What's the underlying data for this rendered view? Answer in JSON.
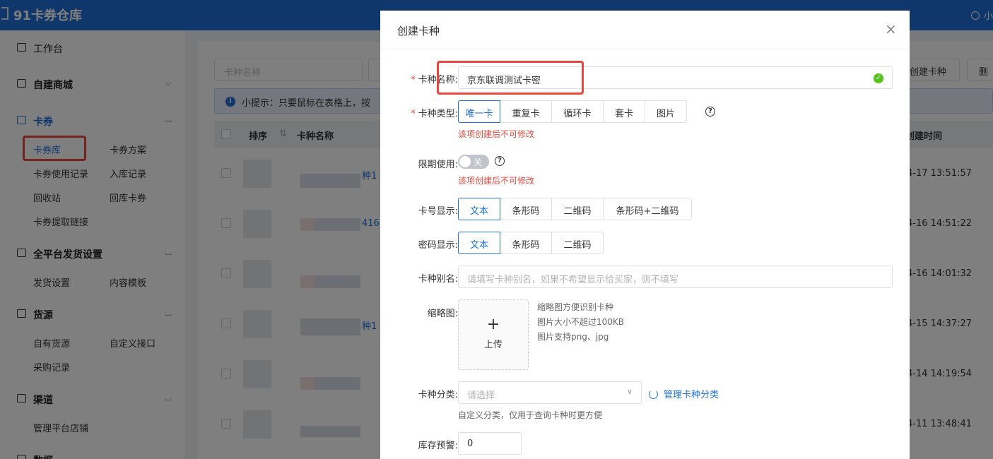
{
  "header": {
    "app_title": "91卡券仓库",
    "user_text": "小"
  },
  "sidebar": {
    "groups": [
      {
        "label": "工作台"
      },
      {
        "label": "自建商城"
      },
      {
        "label": "卡券"
      },
      {
        "label": "全平台发货设置"
      },
      {
        "label": "货源"
      },
      {
        "label": "渠道"
      },
      {
        "label": "数据"
      }
    ],
    "card_items": [
      "卡券库",
      "卡券方案",
      "卡券使用记录",
      "入库记录",
      "回收站",
      "回库卡券",
      "卡券提取链接"
    ],
    "shipping_items": [
      "发货设置",
      "内容模板"
    ],
    "source_items": [
      "自有货源",
      "自定义接口",
      "采购记录"
    ],
    "channel_items": [
      "管理平台店铺"
    ]
  },
  "main": {
    "search_placeholder": "卡种名称",
    "tip_icon": "i",
    "tip": "小提示：只要鼠标在表格上，按",
    "create_button": "创建卡种",
    "delete_button": "删",
    "columns": {
      "sort": "排序",
      "sort_icon": "⇅",
      "name": "卡种名称",
      "created": "创建时间"
    },
    "rows": [
      {
        "link": "种1",
        "date": "4-17 13:51:57"
      },
      {
        "link": "416",
        "date": "4-16 14:51:22"
      },
      {
        "link": "",
        "date": "4-16 14:01:32"
      },
      {
        "link": "种1",
        "date": "4-15 14:37:27"
      },
      {
        "link": "",
        "date": "4-14 14:19:54"
      },
      {
        "link": "",
        "date": "4-11 13:48:41"
      }
    ]
  },
  "dialog": {
    "title": "创建卡种",
    "close": "×",
    "required_mark": "*",
    "name_label": "卡种名称:",
    "name_value": "京东联调测试卡密",
    "name_ok": "✓",
    "type_label": "卡种类型:",
    "type_options": [
      "唯一卡",
      "重复卡",
      "循环卡",
      "套卡",
      "图片"
    ],
    "help_icon": "?",
    "type_warning": "该项创建后不可修改",
    "limit_label": "限期使用:",
    "limit_toggle": "关",
    "limit_warning": "该项创建后不可修改",
    "card_no_label": "卡号显示:",
    "card_no_options": [
      "文本",
      "条形码",
      "二维码",
      "条形码+二维码"
    ],
    "password_label": "密码显示:",
    "password_options": [
      "文本",
      "条形码",
      "二维码"
    ],
    "alias_label": "卡种别名:",
    "alias_placeholder": "请填写卡种别名，如果不希望显示给买家，则不填写",
    "thumb_label": "缩略图:",
    "upload_plus": "+",
    "upload_text": "上传",
    "thumb_hints": [
      "缩略图方便识别卡种",
      "图片大小不超过100KB",
      "图片支持png、jpg"
    ],
    "category_label": "卡种分类:",
    "category_placeholder": "请选择",
    "category_chevron": "∨",
    "manage_category": "管理卡种分类",
    "category_hint": "自定义分类，仅用于查询卡种时更方便",
    "stock_label": "库存预警:",
    "stock_value": "0"
  }
}
